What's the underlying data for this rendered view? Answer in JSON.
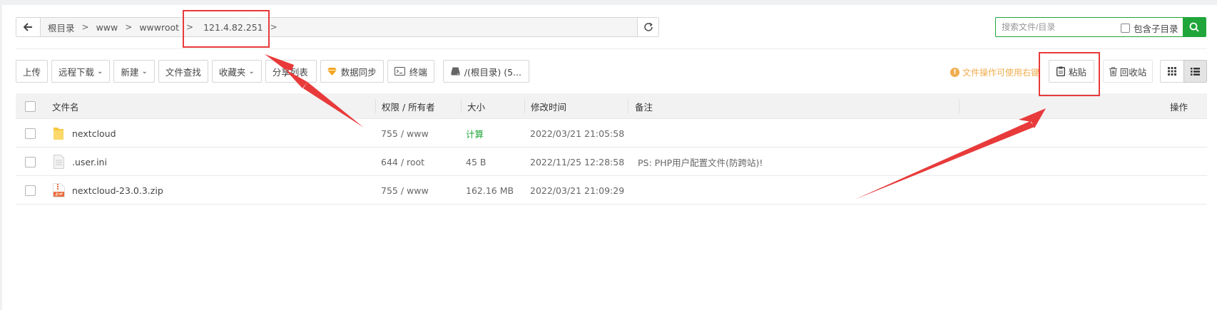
{
  "breadcrumb": {
    "items": [
      "根目录",
      "www",
      "wwwroot",
      "121.4.82.251"
    ]
  },
  "search": {
    "placeholder": "搜索文件/目录",
    "include_subdir_label": "包含子目录"
  },
  "toolbar": {
    "upload": "上传",
    "remote_download": "远程下载",
    "new": "新建",
    "file_search": "文件查找",
    "favorites": "收藏夹",
    "share_list": "分享列表",
    "data_sync": "数据同步",
    "terminal": "终端",
    "disk": "/(根目录) (5...",
    "hint": "文件操作可使用右键",
    "paste": "粘贴",
    "recycle_bin": "回收站"
  },
  "table": {
    "headers": {
      "name": "文件名",
      "perm": "权限 / 所有者",
      "size": "大小",
      "mtime": "修改时间",
      "remark": "备注",
      "ops": "操作"
    },
    "rows": [
      {
        "name": "nextcloud",
        "type": "folder",
        "perm": "755 / www",
        "size": "计算",
        "mtime": "2022/03/21 21:05:58",
        "remark": ""
      },
      {
        "name": ".user.ini",
        "type": "file",
        "perm": "644 / root",
        "size": "45 B",
        "mtime": "2022/11/25 12:28:58",
        "remark": "PS: PHP用户配置文件(防跨站)!"
      },
      {
        "name": "nextcloud-23.0.3.zip",
        "type": "zip",
        "perm": "755 / www",
        "size": "162.16 MB",
        "mtime": "2022/03/21 21:09:29",
        "remark": ""
      }
    ]
  },
  "colors": {
    "accent": "#20a53a",
    "annotation": "#e83a3a",
    "hint": "#f0ad4e"
  }
}
